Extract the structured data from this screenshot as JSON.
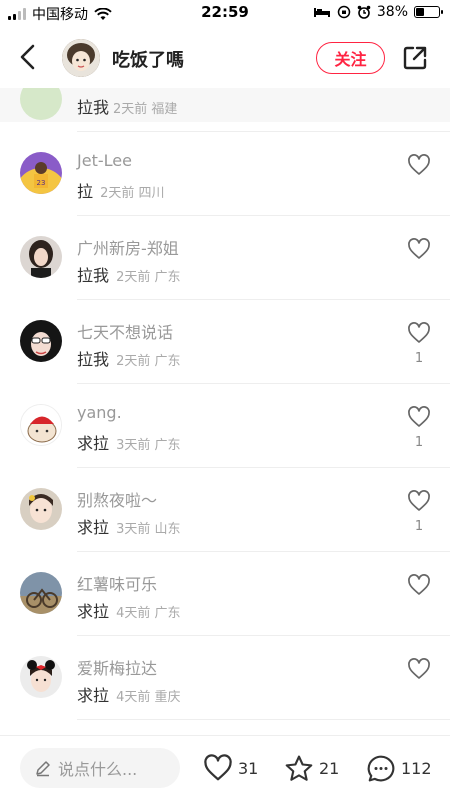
{
  "status_bar": {
    "carrier": "中国移动",
    "time": "22:59",
    "battery": "38%",
    "battery_level": 0.38
  },
  "header": {
    "title": "吃饭了嗎",
    "follow_label": "关注"
  },
  "partial_item": {
    "content": "拉我",
    "meta": "2天前 福建"
  },
  "comments": [
    {
      "name": "Jet-Lee",
      "content": "拉",
      "meta": "2天前 四川",
      "likes": ""
    },
    {
      "name": "广州新房-郑姐",
      "content": "拉我",
      "meta": "2天前 广东",
      "likes": ""
    },
    {
      "name": "七天不想说话",
      "content": "拉我",
      "meta": "2天前 广东",
      "likes": "1"
    },
    {
      "name": "yang.",
      "content": "求拉",
      "meta": "3天前 广东",
      "likes": "1"
    },
    {
      "name": "别熬夜啦～",
      "content": "求拉",
      "meta": "3天前 山东",
      "likes": "1"
    },
    {
      "name": "红薯味可乐",
      "content": "求拉",
      "meta": "4天前 广东",
      "likes": ""
    },
    {
      "name": "爱斯梅拉达",
      "content": "求拉",
      "meta": "4天前 重庆",
      "likes": ""
    }
  ],
  "bottom_bar": {
    "placeholder": "说点什么...",
    "likes": "31",
    "favorites": "21",
    "comments": "112"
  },
  "colors": {
    "accent": "#ff2442"
  },
  "icons": [
    "back-arrow-icon",
    "share-icon",
    "heart-icon",
    "star-icon",
    "chat-bubble-icon",
    "pencil-icon",
    "wifi-icon",
    "signal-icon",
    "battery-icon"
  ]
}
